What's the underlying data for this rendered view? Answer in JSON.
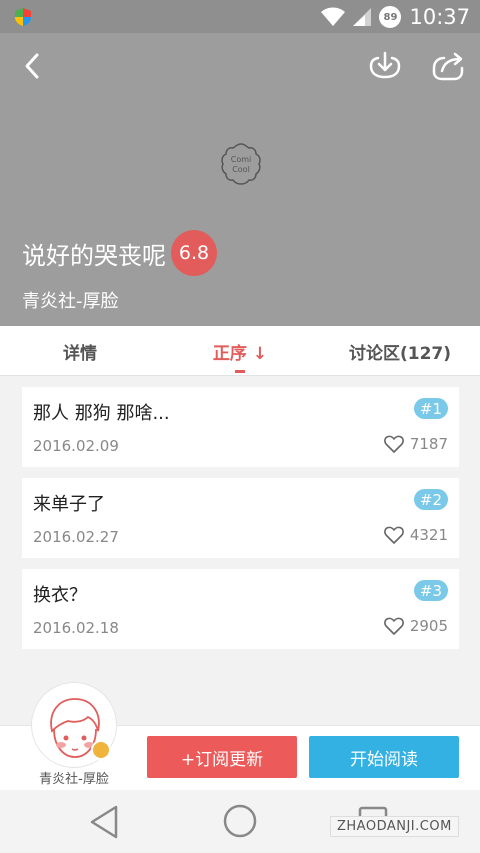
{
  "status_bar": {
    "time": "10:37",
    "battery": "89"
  },
  "header": {
    "title": "说好的哭丧呢",
    "rating": "6.8",
    "author": "青炎社-厚脸",
    "logo_text_top": "Comi",
    "logo_text_bottom": "Cool"
  },
  "tabs": [
    {
      "label": "详情"
    },
    {
      "label": "正序 ↓"
    },
    {
      "label": "讨论区(127)"
    }
  ],
  "episodes": [
    {
      "title": "那人 那狗 那啥...",
      "number": "#1",
      "date": "2016.02.09",
      "likes": "7187"
    },
    {
      "title": "来单子了",
      "number": "#2",
      "date": "2016.02.27",
      "likes": "4321"
    },
    {
      "title": "换衣？",
      "number": "#3",
      "date": "2016.02.18",
      "likes": "2905"
    }
  ],
  "bottom": {
    "author_name": "青炎社-厚脸",
    "subscribe_label": "+订阅更新",
    "read_label": "开始阅读"
  },
  "watermark": "ZHAODANJI.COM",
  "colors": {
    "accent": "#e35c5c",
    "read_button": "#33b1e3",
    "badge": "#7bc9e8"
  }
}
